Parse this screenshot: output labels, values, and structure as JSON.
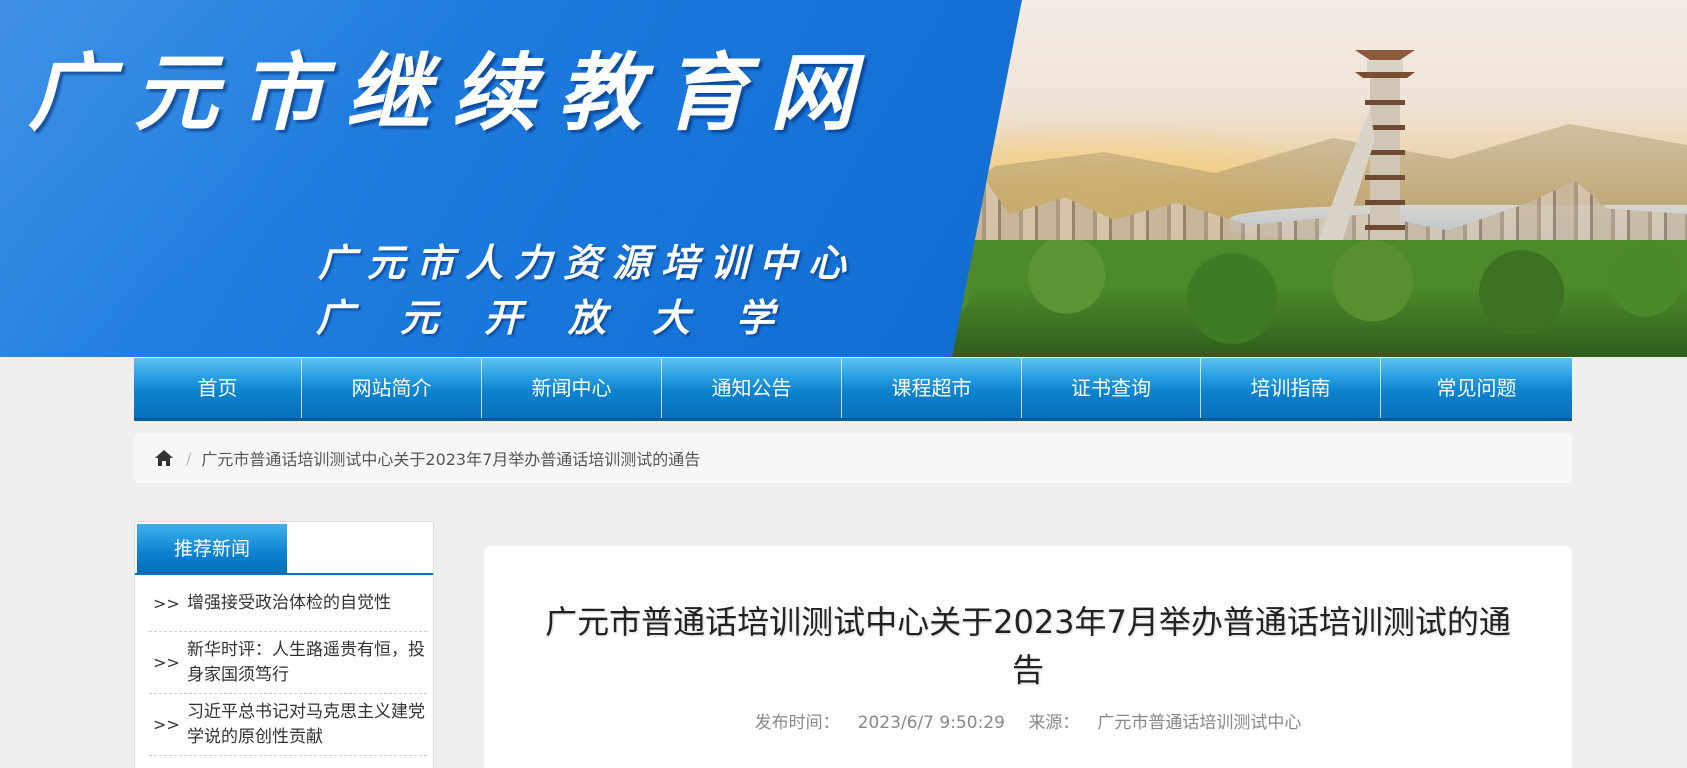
{
  "banner": {
    "title": "广元市继续教育网",
    "subtitle_1": "广元市人力资源培训中心",
    "subtitle_2": "广元开放大学"
  },
  "nav": {
    "items": [
      "首页",
      "网站简介",
      "新闻中心",
      "通知公告",
      "课程超市",
      "证书查询",
      "培训指南",
      "常见问题"
    ]
  },
  "breadcrumb": {
    "separator": "/",
    "current": "广元市普通话培训测试中心关于2023年7月举办普通话培训测试的通告"
  },
  "sidebar": {
    "heading": "推荐新闻",
    "arrow": ">>",
    "items": [
      "增强接受政治体检的自觉性",
      "新华时评：人生路遥贵有恒，投身家国须笃行",
      "习近平总书记对马克思主义建党学说的原创性贡献"
    ]
  },
  "article": {
    "title": "广元市普通话培训测试中心关于2023年7月举办普通话培训测试的通告",
    "publish_label": "发布时间：",
    "publish_time": "2023/6/7 9:50:29",
    "source_label": "来源：",
    "source": "广元市普通话培训测试中心"
  },
  "colors": {
    "nav_top": "#5fc1f0",
    "nav_bottom": "#0a6eb9",
    "banner_blue": "#1673d8"
  },
  "icons": {
    "home": "home-icon"
  }
}
